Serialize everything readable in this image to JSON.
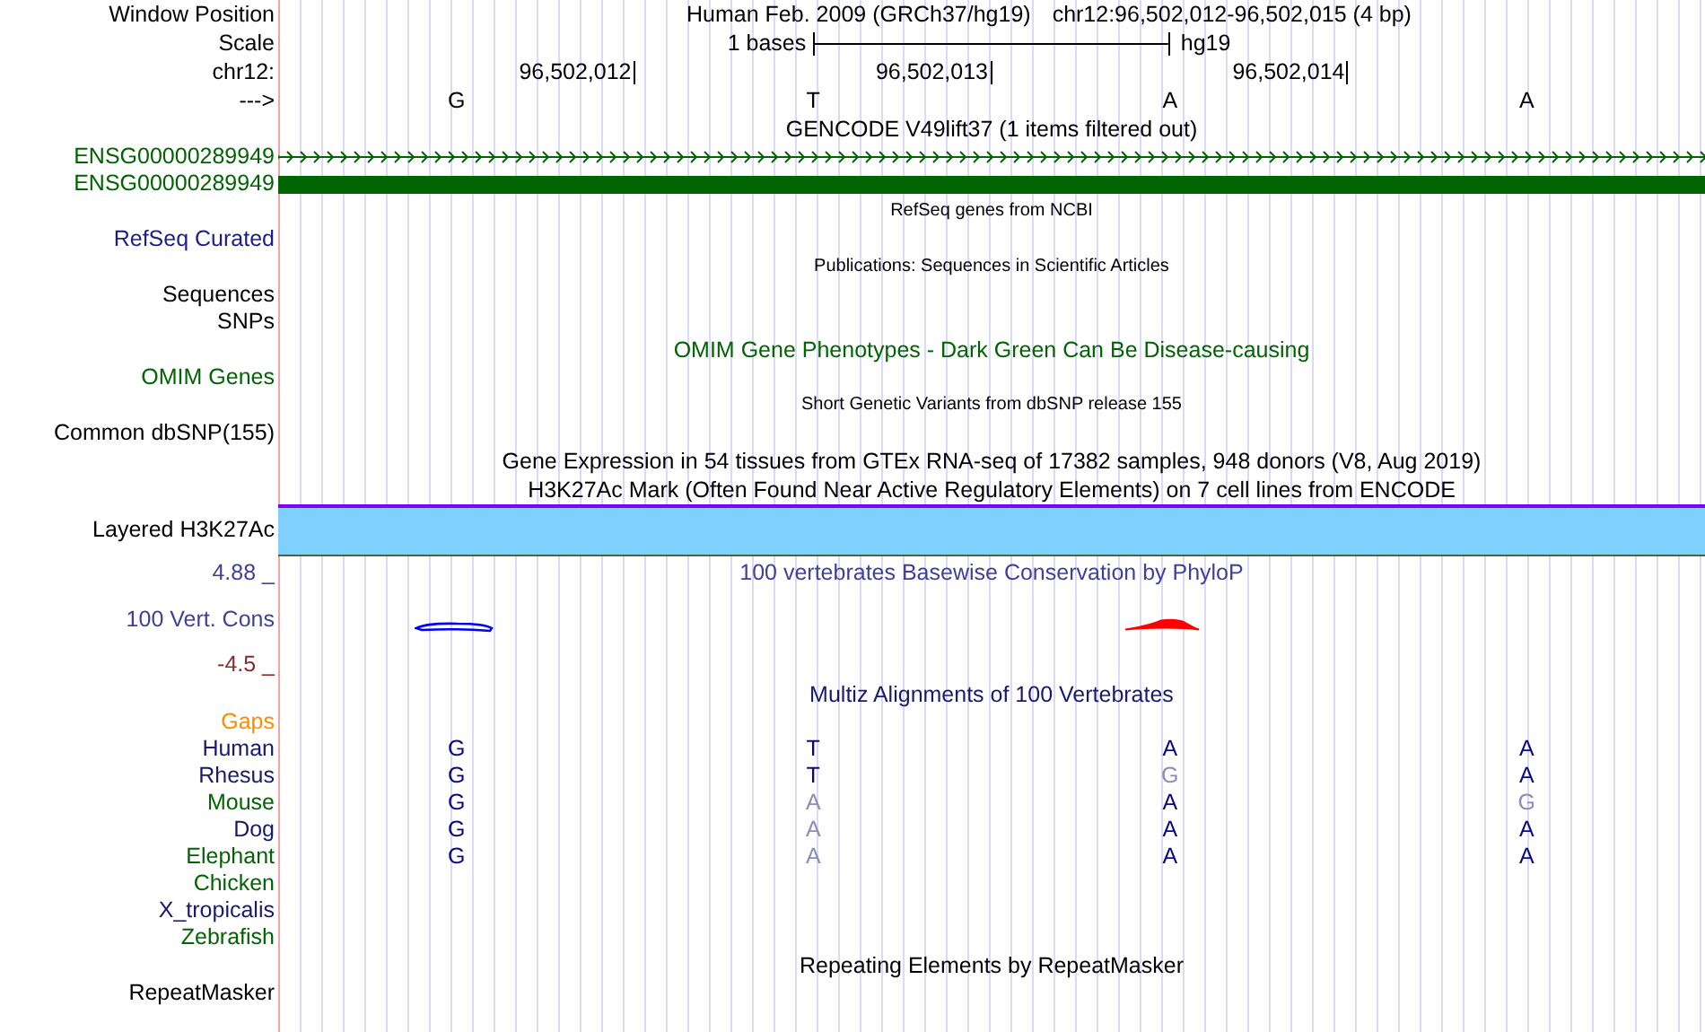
{
  "window_position": {
    "label": "Window Position",
    "assembly": "Human Feb. 2009 (GRCh37/hg19)",
    "position": "chr12:96,502,012-96,502,015 (4 bp)"
  },
  "scale": {
    "label": "Scale",
    "span": "1 bases",
    "assembly": "hg19"
  },
  "ruler": {
    "label": "chr12:",
    "ticks": [
      "96,502,012",
      "96,502,013",
      "96,502,014"
    ]
  },
  "strand": {
    "label": "--->",
    "bases": [
      "G",
      "T",
      "A",
      "A"
    ]
  },
  "tracks": [
    {
      "kind": "title",
      "text": "GENCODE V49lift37 (1 items filtered out)",
      "color": "#000000"
    },
    {
      "kind": "gene_strand",
      "label": "ENSG00000289949",
      "color": "#006400"
    },
    {
      "kind": "gene_block",
      "label": "ENSG00000289949",
      "color": "#006400"
    },
    {
      "kind": "note",
      "text": "RefSeq genes from NCBI"
    },
    {
      "kind": "label",
      "label": "RefSeq Curated",
      "color": "#1c1c8c"
    },
    {
      "kind": "note",
      "text": "Publications: Sequences in Scientific Articles"
    },
    {
      "kind": "label",
      "label": "Sequences",
      "color": "#000000"
    },
    {
      "kind": "label",
      "label": "SNPs",
      "color": "#000000"
    },
    {
      "kind": "title",
      "text": "OMIM Gene Phenotypes - Dark Green Can Be Disease-causing",
      "color": "#006400"
    },
    {
      "kind": "label",
      "label": "OMIM Genes",
      "color": "#006400"
    },
    {
      "kind": "note",
      "text": "Short Genetic Variants from dbSNP release 155"
    },
    {
      "kind": "label",
      "label": "Common dbSNP(155)",
      "color": "#000000"
    },
    {
      "kind": "title",
      "text": "Gene Expression in 54 tissues from GTEx RNA-seq of 17382 samples, 948 donors (V8, Aug 2019)",
      "color": "#000000"
    },
    {
      "kind": "title",
      "text": "H3K27Ac Mark (Often Found Near Active Regulatory Elements) on 7 cell lines from ENCODE",
      "color": "#000000"
    },
    {
      "kind": "band",
      "label": "Layered H3K27Ac"
    },
    {
      "kind": "axis_max",
      "label": "4.88 _",
      "title": "100 vertebrates Basewise Conservation by PhyloP",
      "color": "#40409a"
    },
    {
      "kind": "wiggle",
      "label": "100 Vert. Cons",
      "color": "#40409a"
    },
    {
      "kind": "axis_min",
      "label": "-4.5 _",
      "color": "#8b2a2a"
    },
    {
      "kind": "title",
      "text": "Multiz Alignments of 100 Vertebrates",
      "color": "#191970"
    },
    {
      "kind": "label",
      "label": "Gaps",
      "color": "#ff8c00"
    },
    {
      "kind": "alignment",
      "label": "Human",
      "color": "#191970",
      "bases": [
        {
          "base": "G",
          "matches": true
        },
        {
          "base": "T",
          "matches": true
        },
        {
          "base": "A",
          "matches": true
        },
        {
          "base": "A",
          "matches": true
        }
      ]
    },
    {
      "kind": "alignment",
      "label": "Rhesus",
      "color": "#191970",
      "bases": [
        {
          "base": "G",
          "matches": true
        },
        {
          "base": "T",
          "matches": true
        },
        {
          "base": "G",
          "matches": false
        },
        {
          "base": "A",
          "matches": true
        }
      ]
    },
    {
      "kind": "alignment",
      "label": "Mouse",
      "color": "#006400",
      "bases": [
        {
          "base": "G",
          "matches": true
        },
        {
          "base": "A",
          "matches": false
        },
        {
          "base": "A",
          "matches": true
        },
        {
          "base": "G",
          "matches": false
        }
      ]
    },
    {
      "kind": "alignment",
      "label": "Dog",
      "color": "#191970",
      "bases": [
        {
          "base": "G",
          "matches": true
        },
        {
          "base": "A",
          "matches": false
        },
        {
          "base": "A",
          "matches": true
        },
        {
          "base": "A",
          "matches": true
        }
      ]
    },
    {
      "kind": "alignment",
      "label": "Elephant",
      "color": "#006400",
      "bases": [
        {
          "base": "G",
          "matches": true
        },
        {
          "base": "A",
          "matches": false
        },
        {
          "base": "A",
          "matches": true
        },
        {
          "base": "A",
          "matches": true
        }
      ]
    },
    {
      "kind": "alignment",
      "label": "Chicken",
      "color": "#006400"
    },
    {
      "kind": "alignment",
      "label": "X_tropicalis",
      "color": "#191970"
    },
    {
      "kind": "alignment",
      "label": "Zebrafish",
      "color": "#006400"
    },
    {
      "kind": "title",
      "text": "Repeating Elements by RepeatMasker",
      "color": "#000000"
    },
    {
      "kind": "label",
      "label": "RepeatMasker",
      "color": "#000000"
    }
  ]
}
